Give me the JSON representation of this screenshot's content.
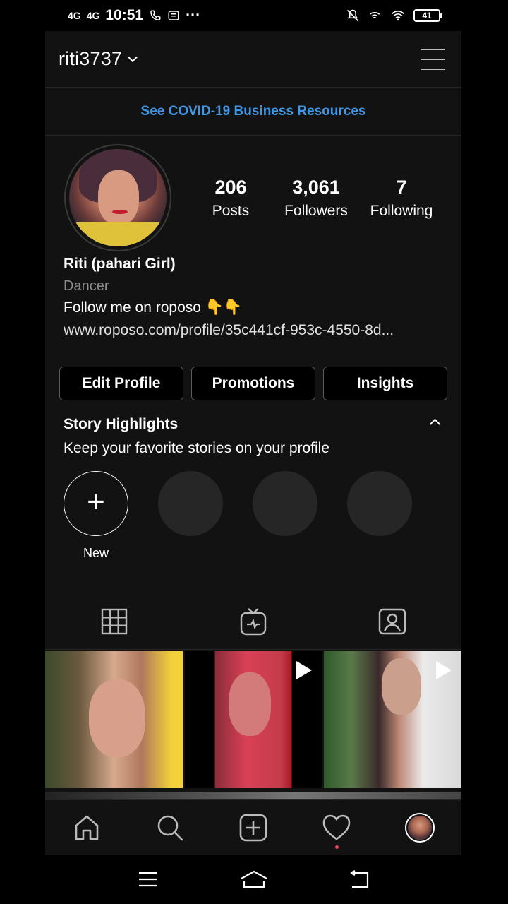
{
  "status_bar": {
    "network": "4G",
    "network2": "4G",
    "time": "10:51",
    "dots": "···",
    "battery": "41"
  },
  "header": {
    "username": "riti3737"
  },
  "banner": {
    "link_text": "See COVID-19 Business Resources"
  },
  "profile": {
    "stats": [
      {
        "value": "206",
        "label": "Posts"
      },
      {
        "value": "3,061",
        "label": "Followers"
      },
      {
        "value": "7",
        "label": "Following"
      }
    ],
    "name": "Riti (pahari Girl)",
    "category": "Dancer",
    "bio": "Follow me on roposo 👇👇",
    "website": "www.roposo.com/profile/35c441cf-953c-4550-8d..."
  },
  "actions": {
    "edit_profile": "Edit Profile",
    "promotions": "Promotions",
    "insights": "Insights"
  },
  "highlights": {
    "title": "Story Highlights",
    "subtitle": "Keep your favorite stories on your profile",
    "new_label": "New",
    "new_icon": "+"
  },
  "icons": {
    "tabs": [
      "grid-icon",
      "igtv-icon",
      "tagged-icon"
    ],
    "nav": [
      "home-icon",
      "search-icon",
      "add-post-icon",
      "activity-heart-icon",
      "profile-avatar-icon"
    ],
    "accent": "#3e97e8",
    "notification_dot": "#ed4956"
  }
}
